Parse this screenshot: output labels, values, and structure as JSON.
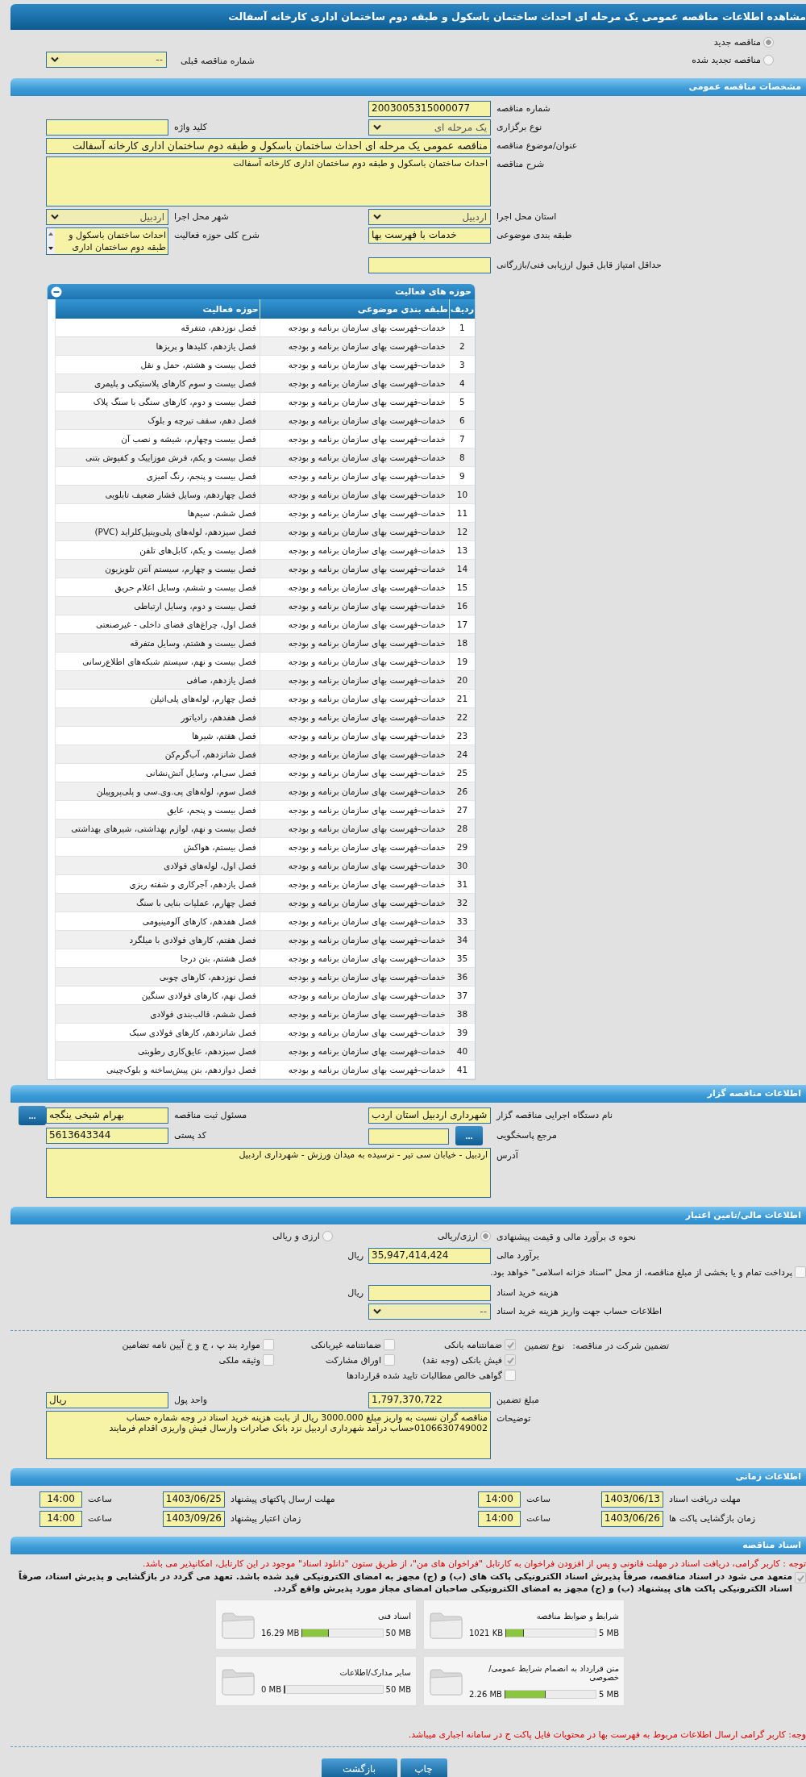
{
  "title": "مشاهده اطلاعات مناقصه عمومی یک مرحله ای احداث ساختمان باسکول و طبقه دوم ساختمان اداری کارخانه آسفالت",
  "tender_status": [
    {
      "label": "مناقصه جدید",
      "selected": true
    },
    {
      "label": "مناقصه تجدید شده",
      "selected": false
    }
  ],
  "previous_tender": {
    "label": "شماره مناقصه قبلی",
    "value": "--"
  },
  "general": {
    "header": "مشخصات مناقصه عمومی",
    "rows": [
      [
        {
          "kind": "input",
          "label": "شماره مناقصه",
          "value": "2003005315000077"
        }
      ],
      [
        {
          "kind": "select",
          "label": "نوع برگزاری",
          "value": "یک مرحله ای"
        },
        {
          "kind": "input",
          "label": "کلید واژه"
        }
      ],
      [
        {
          "kind": "wide",
          "label": "عنوان/موضوع مناقصه",
          "value": "مناقصه عمومی یک مرحله ای احداث ساختمان باسکول و طبقه دوم ساختمان اداری کارخانه آسفالت"
        }
      ],
      [
        {
          "kind": "textarea",
          "label": "شرح مناقصه",
          "value": "احداث ساختمان باسکول و طبقه دوم ساختمان اداری کارخانه آسفالت"
        }
      ],
      [
        {
          "kind": "select",
          "label": "استان محل اجرا",
          "value": "اردبیل"
        },
        {
          "kind": "select",
          "label": "شهر محل اجرا",
          "value": "اردبیل"
        }
      ],
      [
        {
          "kind": "input",
          "label": "طبقه بندی موضوعی",
          "value": "خدمات با فهرست بها"
        },
        {
          "kind": "listbox",
          "label": "شرح کلی حوزه فعالیت",
          "value": "احداث ساختمان باسکول و طبقه دوم ساختمان اداری"
        }
      ],
      [
        {
          "kind": "input",
          "label": "حداقل امتیاز قابل قبول ارزیابی فنی/بازرگانی"
        }
      ]
    ]
  },
  "activities": {
    "header": "حوزه های فعالیت",
    "columns": [
      "ردیف",
      "طبقه بندی موضوعی",
      "حوزه فعالیت"
    ],
    "rows": [
      {
        "no": "1",
        "category": "خدمات-فهرست بهای سازمان برنامه و بودجه",
        "activity": "فصل نوزدهم، متفرقه"
      },
      {
        "no": "2",
        "category": "خدمات-فهرست بهای سازمان برنامه و بودجه",
        "activity": "فصل یازدهم، کلیدها و پریزها"
      },
      {
        "no": "3",
        "category": "خدمات-فهرست بهای سازمان برنامه و بودجه",
        "activity": "فصل بیست و هشتم، حمل و نقل"
      },
      {
        "no": "4",
        "category": "خدمات-فهرست بهای سازمان برنامه و بودجه",
        "activity": "فصل بیست و سوم کارهای پلاستیکی و پلیمری"
      },
      {
        "no": "5",
        "category": "خدمات-فهرست بهای سازمان برنامه و بودجه",
        "activity": "فصل بیست و دوم، کارهای سنگی با سنگ پلاک"
      },
      {
        "no": "6",
        "category": "خدمات-فهرست بهای سازمان برنامه و بودجه",
        "activity": "فصل دهم، سقف تیرچه و بلوک"
      },
      {
        "no": "7",
        "category": "خدمات-فهرست بهای سازمان برنامه و بودجه",
        "activity": "فصل بیست وچهارم، شیشه و نصب آن"
      },
      {
        "no": "8",
        "category": "خدمات-فهرست بهای سازمان برنامه و بودجه",
        "activity": "فصل بیست و یکم، فرش موزاییک و کفپوش بتنی"
      },
      {
        "no": "9",
        "category": "خدمات-فهرست بهای سازمان برنامه و بودجه",
        "activity": "فصل بیست و پنجم، رنگ آمیزی"
      },
      {
        "no": "10",
        "category": "خدمات-فهرست بهای سازمان برنامه و بودجه",
        "activity": "فصل چهاردهم، وسایل فشار ضعیف تابلویی"
      },
      {
        "no": "11",
        "category": "خدمات-فهرست بهای سازمان برنامه و بودجه",
        "activity": "فصل ششم، سیم‌ها"
      },
      {
        "no": "12",
        "category": "خدمات-فهرست بهای سازمان برنامه و بودجه",
        "activity": "فصل سیزدهم، لوله‌های پلی‌وینیل‌کلراید (PVC)"
      },
      {
        "no": "13",
        "category": "خدمات-فهرست بهای سازمان برنامه و بودجه",
        "activity": "فصل بیست و یکم، کابل‌های تلفن"
      },
      {
        "no": "14",
        "category": "خدمات-فهرست بهای سازمان برنامه و بودجه",
        "activity": "فصل بیست و چهارم، سیستم آنتن تلویزیون"
      },
      {
        "no": "15",
        "category": "خدمات-فهرست بهای سازمان برنامه و بودجه",
        "activity": "فصل بیست و ششم، وسایل اعلام حریق"
      },
      {
        "no": "16",
        "category": "خدمات-فهرست بهای سازمان برنامه و بودجه",
        "activity": "فصل بیست و دوم، وسایل ارتباطی"
      },
      {
        "no": "17",
        "category": "خدمات-فهرست بهای سازمان برنامه و بودجه",
        "activity": "فصل اول، چراغ‌های فضای داخلی - غیرصنعتی"
      },
      {
        "no": "18",
        "category": "خدمات-فهرست بهای سازمان برنامه و بودجه",
        "activity": "فصل بیست و هشتم، وسایل متفرقه"
      },
      {
        "no": "19",
        "category": "خدمات-فهرست بهای سازمان برنامه و بودجه",
        "activity": "فصل بیست و نهم، سیستم شبکه‌های اطلاع‌رسانی"
      },
      {
        "no": "20",
        "category": "خدمات-فهرست بهای سازمان برنامه و بودجه",
        "activity": "فصل یازدهم، صافی"
      },
      {
        "no": "21",
        "category": "خدمات-فهرست بهای سازمان برنامه و بودجه",
        "activity": "فصل چهارم، لوله‌های پلی‌اتیلن"
      },
      {
        "no": "22",
        "category": "خدمات-فهرست بهای سازمان برنامه و بودجه",
        "activity": "فصل هفدهم، رادیاتور"
      },
      {
        "no": "23",
        "category": "خدمات-فهرست بهای سازمان برنامه و بودجه",
        "activity": "فصل هفتم، شیرها"
      },
      {
        "no": "24",
        "category": "خدمات-فهرست بهای سازمان برنامه و بودجه",
        "activity": "فصل شانزدهم، آب‌گرم‌کن"
      },
      {
        "no": "25",
        "category": "خدمات-فهرست بهای سازمان برنامه و بودجه",
        "activity": "فصل سی‌ام، وسایل آتش‌نشانی"
      },
      {
        "no": "26",
        "category": "خدمات-فهرست بهای سازمان برنامه و بودجه",
        "activity": "فصل سوم، لوله‌های پی.وی.سی و پلی‌پروپیلن"
      },
      {
        "no": "27",
        "category": "خدمات-فهرست بهای سازمان برنامه و بودجه",
        "activity": "فصل بیست و پنجم، عایق"
      },
      {
        "no": "28",
        "category": "خدمات-فهرست بهای سازمان برنامه و بودجه",
        "activity": "فصل بیست و نهم، لوازم بهداشتی، شیرهای بهداشتی"
      },
      {
        "no": "29",
        "category": "خدمات-فهرست بهای سازمان برنامه و بودجه",
        "activity": "فصل بیستم، هواکش"
      },
      {
        "no": "30",
        "category": "خدمات-فهرست بهای سازمان برنامه و بودجه",
        "activity": "فصل اول، لوله‌های فولادی"
      },
      {
        "no": "31",
        "category": "خدمات-فهرست بهای سازمان برنامه و بودجه",
        "activity": "فصل یازدهم، آجرکاری و شفته ریزی"
      },
      {
        "no": "32",
        "category": "خدمات-فهرست بهای سازمان برنامه و بودجه",
        "activity": "فصل چهارم، عملیات بنایی با سنگ"
      },
      {
        "no": "33",
        "category": "خدمات-فهرست بهای سازمان برنامه و بودجه",
        "activity": "فصل هفدهم، کارهای آلومینیومی"
      },
      {
        "no": "34",
        "category": "خدمات-فهرست بهای سازمان برنامه و بودجه",
        "activity": "فصل هفتم، کارهای فولادی با میلگرد"
      },
      {
        "no": "35",
        "category": "خدمات-فهرست بهای سازمان برنامه و بودجه",
        "activity": "فصل هشتم، بتن درجا"
      },
      {
        "no": "36",
        "category": "خدمات-فهرست بهای سازمان برنامه و بودجه",
        "activity": "فصل نوزدهم، کارهای چوبی"
      },
      {
        "no": "37",
        "category": "خدمات-فهرست بهای سازمان برنامه و بودجه",
        "activity": "فصل نهم، کارهای فولادی سنگین"
      },
      {
        "no": "38",
        "category": "خدمات-فهرست بهای سازمان برنامه و بودجه",
        "activity": "فصل ششم، قالب‌بندی فولادی"
      },
      {
        "no": "39",
        "category": "خدمات-فهرست بهای سازمان برنامه و بودجه",
        "activity": "فصل شانزدهم، کارهای فولادی سبک"
      },
      {
        "no": "40",
        "category": "خدمات-فهرست بهای سازمان برنامه و بودجه",
        "activity": "فصل سیزدهم، عایق‌کاری رطوبتی"
      },
      {
        "no": "41",
        "category": "خدمات-فهرست بهای سازمان برنامه و بودجه",
        "activity": "فصل دوازدهم، بتن پیش‌ساخته و بلوک‌چینی"
      }
    ]
  },
  "organizer": {
    "header": "اطلاعات مناقصه گزار",
    "rows": [
      [
        {
          "kind": "input",
          "label": "نام دستگاه اجرایی مناقصه گزار",
          "value": "شهرداری اردبیل استان اردب"
        },
        {
          "kind": "input",
          "label": "مسئول ثبت مناقصه",
          "value": "بهرام شیخی ینگجه",
          "button": "..."
        }
      ],
      [
        {
          "kind": "input",
          "label": "مرجع پاسخگویی",
          "button": "..."
        },
        {
          "kind": "input",
          "label": "کد پستی",
          "value": "5613643344"
        }
      ],
      [
        {
          "kind": "textarea",
          "label": "آدرس",
          "value": "اردبیل - خیابان سی تیر - نرسیده به میدان ورزش - شهرداری اردبیل"
        }
      ]
    ]
  },
  "financial": {
    "header": "اطلاعات مالی/تامین اعتبار",
    "rows": [
      [
        {
          "kind": "radios",
          "label": "نحوه ی برآورد مالی و قیمت پیشنهادی",
          "options": [
            {
              "label": "ارزی/ریالی",
              "selected": true
            },
            {
              "label": "ارزی و ریالی",
              "selected": false
            }
          ]
        }
      ],
      [
        {
          "kind": "input",
          "label": "برآورد مالی",
          "value": "35,947,414,424",
          "unit": "ریال"
        }
      ],
      [
        {
          "kind": "checkline",
          "label": "پرداخت تمام و یا بخشی از مبلغ مناقصه، از محل \"اسناد خزانه اسلامی\" خواهد بود.",
          "checked": false
        }
      ],
      [
        {
          "kind": "input",
          "label": "هزینه خرید اسناد",
          "unit": "ریال"
        }
      ],
      [
        {
          "kind": "select",
          "label": "اطلاعات حساب جهت واریز هزینه خرید اسناد",
          "value": "--"
        }
      ]
    ],
    "guarantee": {
      "title": "تضمین شرکت در مناقصه:",
      "type_label": "نوع تضمین",
      "options": [
        {
          "label": "ضمانتنامه بانکی",
          "checked": true
        },
        {
          "label": "ضمانتنامه غیربانکی",
          "checked": false
        },
        {
          "label": "موارد بند پ ، ج و خ آیین نامه تضامین",
          "checked": false
        },
        {
          "label": "فیش بانکی (وجه نقد)",
          "checked": true
        },
        {
          "label": "اوراق مشارکت",
          "checked": false
        },
        {
          "label": "وثیقه ملکی",
          "checked": false
        },
        {
          "label": "گواهی خالص مطالبات تایید شده قراردادها",
          "checked": false
        }
      ]
    },
    "rows2": [
      [
        {
          "kind": "input",
          "label": "مبلغ تضمین",
          "value": "1,797,370,722"
        },
        {
          "kind": "input",
          "label": "واحد پول",
          "value": "ریال"
        }
      ],
      [
        {
          "kind": "textarea",
          "label": "توضیحات",
          "value": "مناقصه گران نسبت به واریز مبلغ 3000.000 ریال از بابت هزینه خرید اسناد در وجه شماره حساب 0106630749002حساب درآمد شهرداری اردبیل نزد بانک صادرات وارسال فیش واریزی اقدام فرمایند"
        }
      ]
    ]
  },
  "schedule": {
    "header": "اطلاعات زمانی",
    "rows": [
      [
        {
          "label": "مهلت دریافت اسناد",
          "date": "1403/06/13",
          "time_label": "ساعت",
          "time": "14:00"
        },
        {
          "label": "مهلت ارسال پاکتهای پیشنهاد",
          "date": "1403/06/25",
          "time_label": "ساعت",
          "time": "14:00"
        }
      ],
      [
        {
          "label": "زمان بازگشایی پاکت ها",
          "date": "1403/06/26",
          "time_label": "ساعت",
          "time": "14:00"
        },
        {
          "label": "زمان اعتبار پیشنهاد",
          "date": "1403/09/26",
          "time_label": "ساعت",
          "time": "14:00"
        }
      ]
    ]
  },
  "documents": {
    "header": "اسناد مناقصه",
    "notice": "توجه : کاربر گرامی، دریافت اسناد در مهلت قانونی و پس از افزودن فراخوان به کارتابل \"فراخوان های من\"، از طریق ستون \"دانلود اسناد\" موجود در این کارتابل، امکانپذیر می باشد.",
    "commitment": {
      "checked": true,
      "text": "متعهد می شود در اسناد مناقصه، صرفاً پذیرش اسناد الکترونیکی پاکت های (ب) و (ج) مجهز به امضای الکترونیکی قید شده باشد. تعهد می گردد در بازگشایی و پذیرش اسناد، صرفاً اسناد الکترونیکی پاکت های پیشنهاد (ب) و (ج) مجهز به امضای الکترونیکی صاحبان امضای مجاز مورد پذیرش واقع گردد."
    },
    "files": [
      {
        "title": "شرایط و ضوابط مناقصه",
        "used": "1021 KB",
        "max": "5 MB",
        "level": 0.2
      },
      {
        "title": "اسناد فنی",
        "used": "16.29 MB",
        "max": "50 MB",
        "level": 0.33
      },
      {
        "title": "متن قرارداد به انضمام شرایط عمومی/خصوصی",
        "used": "2.26 MB",
        "max": "5 MB",
        "level": 0.45
      },
      {
        "title": "سایر مدارک/اطلاعات",
        "used": "0 MB",
        "max": "50 MB",
        "level": 0
      }
    ],
    "footnote": "وجه: کاربر گرامی ارسال اطلاعات مربوط به فهرست بها در محتویات فایل پاکت ج در سامانه اجباری میباشد."
  },
  "buttons": [
    "چاپ",
    "بازگشت"
  ]
}
